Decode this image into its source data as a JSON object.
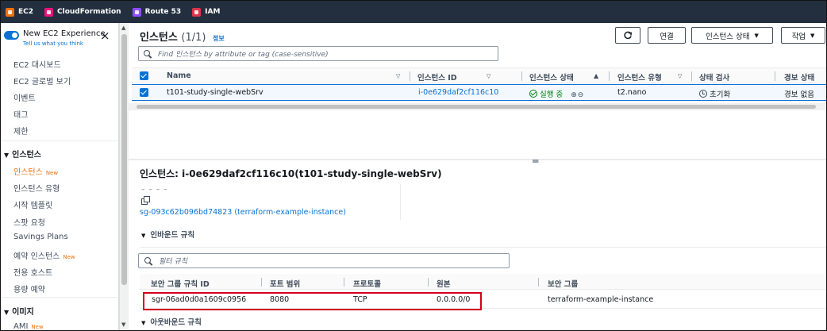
{
  "favorites": [
    {
      "label": "EC2",
      "color": "#ec7211"
    },
    {
      "label": "CloudFormation",
      "color": "#e7157b"
    },
    {
      "label": "Route 53",
      "color": "#8c4fff"
    },
    {
      "label": "IAM",
      "color": "#dd344c"
    }
  ],
  "sidebar": {
    "experience_title": "New EC2 Experience",
    "experience_sub": "Tell us what you think",
    "items": [
      "EC2 대시보드",
      "EC2 글로벌 보기",
      "이벤트",
      "태그",
      "제한"
    ],
    "section_instances": "인스턴스",
    "instance_items": [
      {
        "label": "인스턴스",
        "badge": "New"
      },
      {
        "label": "인스턴스 유형",
        "badge": ""
      },
      {
        "label": "시작 템플릿",
        "badge": ""
      },
      {
        "label": "스팟 요청",
        "badge": ""
      },
      {
        "label": "Savings Plans",
        "badge": ""
      },
      {
        "label": "예약 인스턴스",
        "badge": "New"
      },
      {
        "label": "전용 호스트",
        "badge": ""
      },
      {
        "label": "용량 예약",
        "badge": ""
      }
    ],
    "section_images": "이미지",
    "image_items": [
      {
        "label": "AMI",
        "badge": "New"
      }
    ]
  },
  "header": {
    "title": "인스턴스",
    "count": "(1/1)",
    "info": "정보",
    "buttons": {
      "connect": "연결",
      "state": "인스턴스 상태",
      "actions": "작업"
    },
    "search_placeholder": "Find 인스턴스 by attribute or tag (case-sensitive)"
  },
  "table": {
    "columns": [
      "Name",
      "인스턴스 ID",
      "인스턴스 상태",
      "인스턴스 유형",
      "상태 검사",
      "경보 상태"
    ],
    "row": {
      "name": "t101-study-single-webSrv",
      "id": "i-0e629daf2cf116c10",
      "state": "실행 중",
      "type": "t2.nano",
      "status_check": "초기화",
      "alarm": "경보 없음"
    }
  },
  "detail": {
    "title": "인스턴스: i-0e629daf2cf116c10(t101-study-single-webSrv)",
    "dash": "– – – –",
    "sg_link": "sg-093c62b096bd74823 (terraform-example-instance)",
    "inbound_title": "인바운드 규칙",
    "inbound_search_placeholder": "필터 규칙",
    "inbound_columns": [
      "보안 그룹 규칙 ID",
      "포트 범위",
      "프로토콜",
      "원본",
      "보안 그룹"
    ],
    "inbound_row": {
      "rule_id": "sgr-06ad0d0a1609c0956",
      "port": "8080",
      "protocol": "TCP",
      "source": "0.0.0.0/0",
      "sg": "terraform-example-instance"
    },
    "outbound_title": "아웃바운드 규칙"
  }
}
